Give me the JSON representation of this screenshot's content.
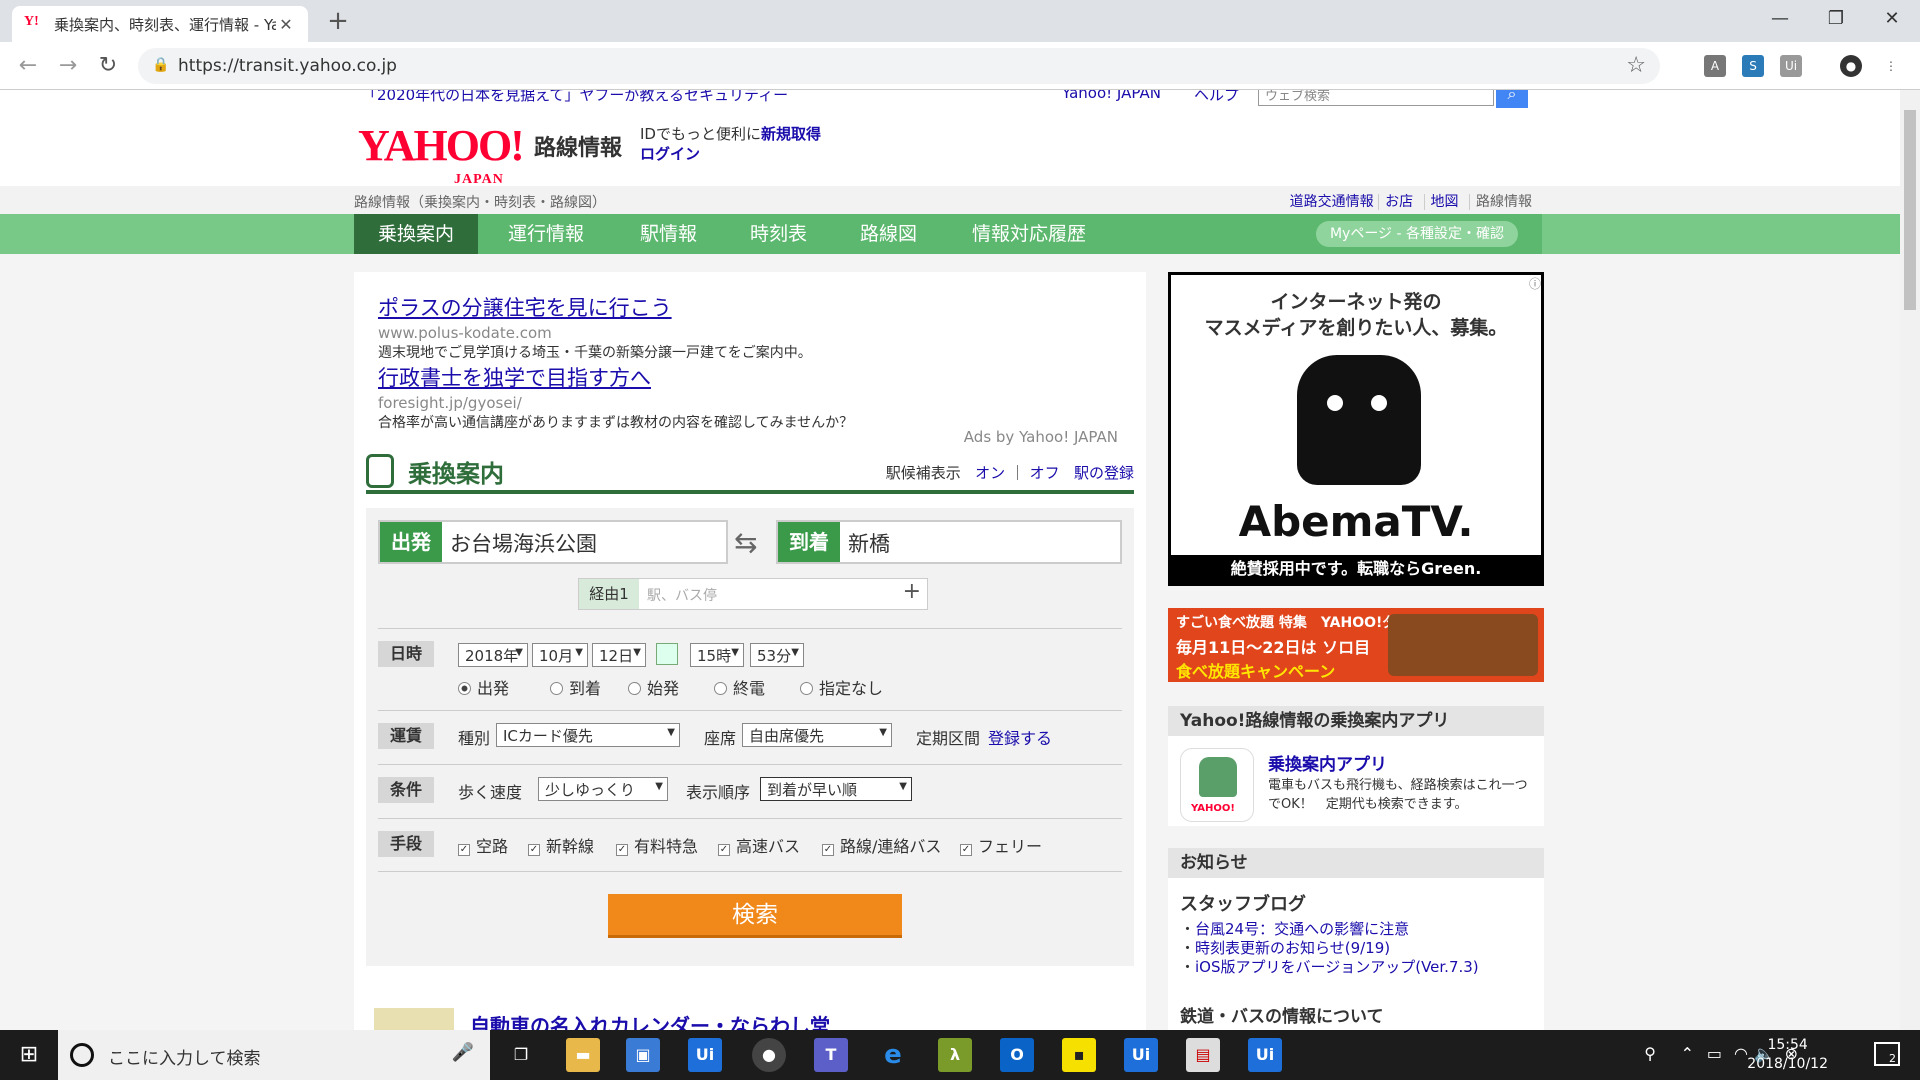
{
  "browser": {
    "tab_title": "乗換案内、時刻表、運行情報 - Ya",
    "tab_favicon": "Y!",
    "url": "https://transit.yahoo.co.jp"
  },
  "header": {
    "top_notice": "「2020年代の日本を見据えて」ヤフーが教えるセキュリティー",
    "yahoo_japan_link": "Yahoo! JAPAN",
    "help_link": "ヘルプ",
    "search_placeholder": "ウェブ検索",
    "logo_text": "YAHOO!",
    "logo_sub": "JAPAN",
    "service_name": "路線情報",
    "id_text": "IDでもっと便利に",
    "signup_link": "新規取得",
    "login_link": "ログイン"
  },
  "subbar": {
    "breadcrumb": "路線情報（乗換案内・時刻表・路線図）",
    "links": [
      "道路交通情報",
      "お店",
      "地図",
      "路線情報"
    ]
  },
  "global_nav": {
    "items": [
      "乗換案内",
      "運行情報",
      "駅情報",
      "時刻表",
      "路線図",
      "情報対応履歴"
    ],
    "mypage": "Myページ - 各種設定・確認"
  },
  "ads": [
    {
      "title": "ポラスの分譲住宅を見に行こう",
      "url": "www.polus-kodate.com",
      "desc": "週末現地でご見学頂ける埼玉・千葉の新築分譲一戸建てをご案内中。"
    },
    {
      "title": "行政書士を独学で目指す方へ",
      "url": "foresight.jp/gyosei/",
      "desc": "合格率が高い通信講座がありますまずは教材の内容を確認してみませんか？"
    }
  ],
  "ads_by": "Ads by Yahoo! JAPAN",
  "transfer": {
    "title": "乗換案内",
    "candidate_label": "駅候補表示",
    "on": "オン",
    "off": "オフ",
    "register_station": "駅の登録",
    "from_label": "出発",
    "from_value": "お台場海浜公園",
    "to_label": "到着",
    "to_value": "新橋",
    "via_label": "経由1",
    "via_placeholder": "駅、バス停",
    "datetime_label": "日時",
    "year": "2018年",
    "month": "10月",
    "day": "12日",
    "hour": "15時",
    "minute": "53分",
    "time_types": [
      "出発",
      "到着",
      "始発",
      "終電",
      "指定なし"
    ],
    "fare_label": "運賃",
    "type_label": "種別",
    "type_value": "ICカード優先",
    "seat_label": "座席",
    "seat_value": "自由席優先",
    "pass_label": "定期区間",
    "pass_link": "登録する",
    "cond_label": "条件",
    "walk_label": "歩く速度",
    "walk_value": "少しゆっくり",
    "order_label": "表示順序",
    "order_value": "到着が早い順",
    "means_label": "手段",
    "means": [
      "空路",
      "新幹線",
      "有料特急",
      "高速バス",
      "路線/連絡バス",
      "フェリー"
    ],
    "search_button": "検索"
  },
  "right": {
    "ad_abema_line1": "インターネット発の",
    "ad_abema_line2": "マスメディアを創りたい人、募集。",
    "ad_abema_brand": "AbemaTV.",
    "ad_abema_footer": "絶賛採用中です。転職ならGreen.",
    "ad_food_a": "すごい食べ放題 特集　YAHOO!ダイニング",
    "ad_food_b": "毎月11日〜22日は ソロ目",
    "ad_food_c": "食べ放題キャンペーン",
    "app_header": "Yahoo!路線情報の乗換案内アプリ",
    "app_title": "乗換案内アプリ",
    "app_desc": "電車もバスも飛行機も、経路検索はこれ一つでOK！　定期代も検索できます。",
    "app_icon_brand": "YAHOO!",
    "news_header": "お知らせ",
    "staff_blog": "スタッフブログ",
    "news": [
      "台風24号：交通への影響に注意",
      "時刻表更新のお知らせ(9/19)",
      "iOS版アプリをバージョンアップ(Ver.7.3)"
    ],
    "partial_more": "鉄道・バスの情報について"
  },
  "partial_bottom": "自動車の名入れカレンダー・ならわし堂",
  "taskbar": {
    "search_text": "ここに入力して検索",
    "time": "15:54",
    "date": "2018/10/12",
    "notifications": "2"
  }
}
